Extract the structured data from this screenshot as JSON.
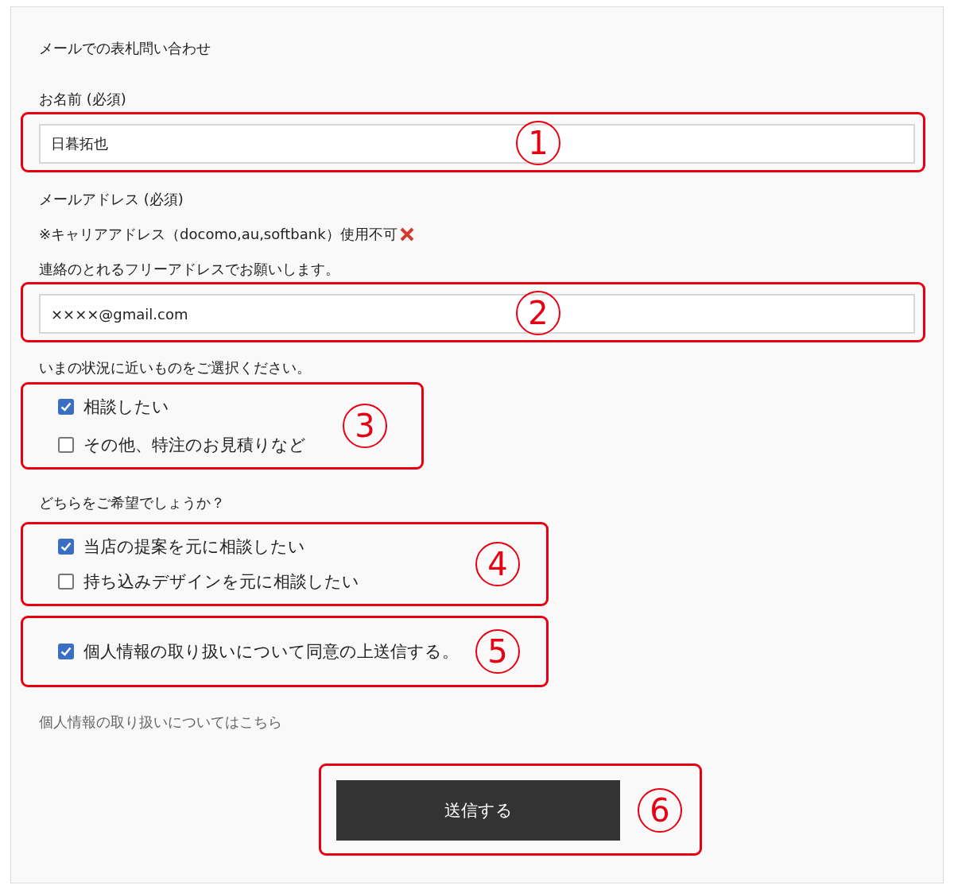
{
  "title": "メールでの表札問い合わせ",
  "name_field": {
    "label": "お名前 (必須)",
    "value": "日暮拓也",
    "marker": "1"
  },
  "email_field": {
    "label": "メールアドレス (必須)",
    "notes": [
      {
        "text": "※キャリアアドレス（docomo,au,softbank）使用不可",
        "kind": "prohibited"
      },
      {
        "text": "連絡のとれるフリーアドレスでお願いします。",
        "kind": "plain"
      }
    ],
    "value": "××××@gmail.com",
    "marker": "2"
  },
  "groups": [
    {
      "question": "いまの状況に近いものをご選択ください。",
      "marker": "3",
      "options": [
        {
          "label": "相談したい",
          "checked": true
        },
        {
          "label": "その他、特注のお見積りなど",
          "checked": false
        }
      ]
    },
    {
      "question": "どちらをご希望でしょうか？",
      "marker": "4",
      "options": [
        {
          "label": "当店の提案を元に相談したい",
          "checked": true
        },
        {
          "label": "持ち込みデザインを元に相談したい",
          "checked": false
        }
      ]
    },
    {
      "marker": "5",
      "options": [
        {
          "label": "個人情報の取り扱いについて同意の上送信する。",
          "checked": true
        }
      ]
    }
  ],
  "privacy_link": "個人情報の取り扱いについてはこちら",
  "submit": {
    "label": "送信する",
    "marker": "6"
  }
}
